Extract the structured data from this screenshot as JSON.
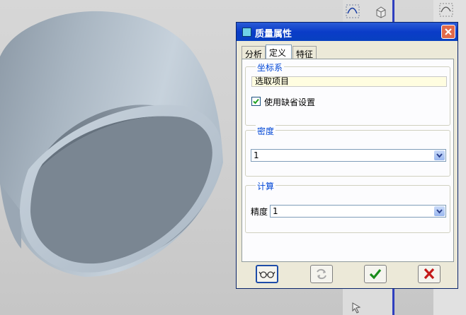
{
  "dialog": {
    "title": "质量属性",
    "tabs": [
      {
        "label": "分析",
        "active": false
      },
      {
        "label": "定义",
        "active": true
      },
      {
        "label": "特征",
        "active": false
      }
    ],
    "coordinate_system": {
      "group_label": "坐标系",
      "selector_value": "选取项目",
      "checkbox_label": "使用缺省设置",
      "checkbox_checked": true
    },
    "density": {
      "group_label": "密度",
      "value": "1"
    },
    "calculation": {
      "group_label": "计算",
      "precision_label": "精度",
      "precision_value": "1"
    },
    "buttons": {
      "preview_icon": "glasses-icon",
      "repeat_icon": "refresh-icon",
      "ok_icon": "checkmark-icon",
      "cancel_icon": "x-icon"
    }
  },
  "colors": {
    "titlebar": "#0a3cc8",
    "group_label": "#0046d5",
    "ok_green": "#1a8c1a",
    "cancel_red": "#c41a1a",
    "model": "#b7c3cf"
  }
}
